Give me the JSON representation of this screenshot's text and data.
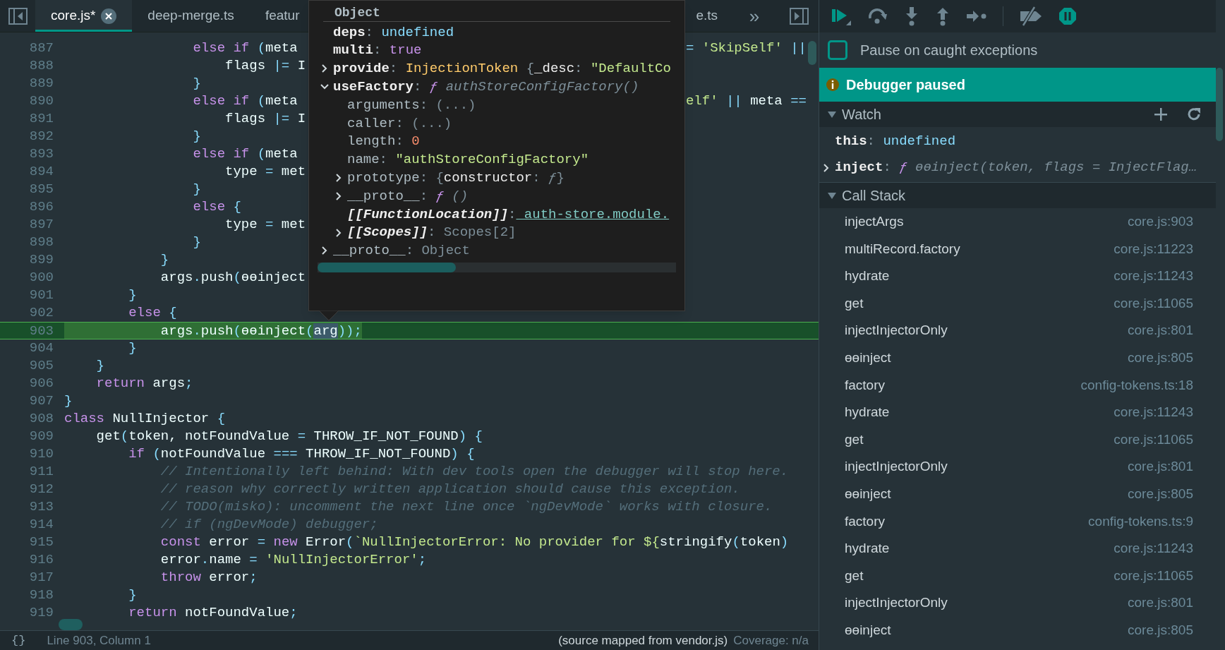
{
  "tabs": [
    {
      "label": "core.js*",
      "selected": true,
      "closable": true
    },
    {
      "label": "deep-merge.ts",
      "selected": false,
      "closable": false
    },
    {
      "label": "featur",
      "selected": false,
      "closable": false
    },
    {
      "label": "e.ts",
      "selected": false,
      "closable": false
    }
  ],
  "overflow_tabs": "»",
  "code": {
    "lines": [
      {
        "number": "887",
        "current": false,
        "tokens": [
          {
            "kind": "keyword",
            "text": "                else if"
          },
          {
            "kind": "punct",
            "text": " ("
          },
          {
            "kind": "ident",
            "text": "meta"
          }
        ],
        "tail": [
          {
            "kind": "punct",
            "text": "="
          },
          {
            "kind": "string",
            "text": " 'SkipSelf'"
          },
          {
            "kind": "punct",
            "text": " ||"
          }
        ]
      },
      {
        "number": "888",
        "current": false,
        "tokens": [
          {
            "kind": "ident",
            "text": "                    flags"
          },
          {
            "kind": "punct",
            "text": " |="
          },
          {
            "kind": "ident",
            "text": " I"
          }
        ]
      },
      {
        "number": "889",
        "current": false,
        "tokens": [
          {
            "kind": "punct",
            "text": "                }"
          }
        ]
      },
      {
        "number": "890",
        "current": false,
        "tokens": [
          {
            "kind": "keyword",
            "text": "                else if"
          },
          {
            "kind": "punct",
            "text": " ("
          },
          {
            "kind": "ident",
            "text": "meta"
          }
        ],
        "tail": [
          {
            "kind": "string",
            "text": "elf'"
          },
          {
            "kind": "punct",
            "text": " ||"
          },
          {
            "kind": "ident",
            "text": " meta"
          },
          {
            "kind": "punct",
            "text": " =="
          }
        ]
      },
      {
        "number": "891",
        "current": false,
        "tokens": [
          {
            "kind": "ident",
            "text": "                    flags"
          },
          {
            "kind": "punct",
            "text": " |="
          },
          {
            "kind": "ident",
            "text": " I"
          }
        ]
      },
      {
        "number": "892",
        "current": false,
        "tokens": [
          {
            "kind": "punct",
            "text": "                }"
          }
        ]
      },
      {
        "number": "893",
        "current": false,
        "tokens": [
          {
            "kind": "keyword",
            "text": "                else if"
          },
          {
            "kind": "punct",
            "text": " ("
          },
          {
            "kind": "ident",
            "text": "meta"
          }
        ]
      },
      {
        "number": "894",
        "current": false,
        "tokens": [
          {
            "kind": "ident",
            "text": "                    type"
          },
          {
            "kind": "punct",
            "text": " ="
          },
          {
            "kind": "ident",
            "text": " met"
          }
        ]
      },
      {
        "number": "895",
        "current": false,
        "tokens": [
          {
            "kind": "punct",
            "text": "                }"
          }
        ]
      },
      {
        "number": "896",
        "current": false,
        "tokens": [
          {
            "kind": "keyword",
            "text": "                else"
          },
          {
            "kind": "punct",
            "text": " {"
          }
        ]
      },
      {
        "number": "897",
        "current": false,
        "tokens": [
          {
            "kind": "ident",
            "text": "                    type"
          },
          {
            "kind": "punct",
            "text": " ="
          },
          {
            "kind": "ident",
            "text": " met"
          }
        ]
      },
      {
        "number": "898",
        "current": false,
        "tokens": [
          {
            "kind": "punct",
            "text": "                }"
          }
        ]
      },
      {
        "number": "899",
        "current": false,
        "tokens": [
          {
            "kind": "punct",
            "text": "            }"
          }
        ]
      },
      {
        "number": "900",
        "current": false,
        "tokens": [
          {
            "kind": "ident",
            "text": "            args"
          },
          {
            "kind": "punct",
            "text": "."
          },
          {
            "kind": "ident",
            "text": "push"
          },
          {
            "kind": "punct",
            "text": "("
          },
          {
            "kind": "ident",
            "text": "ɵɵinject"
          }
        ]
      },
      {
        "number": "901",
        "current": false,
        "tokens": [
          {
            "kind": "punct",
            "text": "        }"
          }
        ]
      },
      {
        "number": "902",
        "current": false,
        "tokens": [
          {
            "kind": "keyword",
            "text": "        else"
          },
          {
            "kind": "punct",
            "text": " {"
          }
        ]
      },
      {
        "number": "903",
        "current": true,
        "tokens": [
          {
            "kind": "ident",
            "text": "            args"
          },
          {
            "kind": "punct",
            "text": "."
          },
          {
            "kind": "ident",
            "text": "push"
          },
          {
            "kind": "punct",
            "text": "("
          },
          {
            "kind": "ident",
            "text": "ɵɵinject"
          },
          {
            "kind": "punct",
            "text": "("
          },
          {
            "kind": "hovered",
            "text": "arg"
          },
          {
            "kind": "punct",
            "text": "));"
          }
        ]
      },
      {
        "number": "904",
        "current": false,
        "tokens": [
          {
            "kind": "punct",
            "text": "        }"
          }
        ]
      },
      {
        "number": "905",
        "current": false,
        "tokens": [
          {
            "kind": "punct",
            "text": "    }"
          }
        ]
      },
      {
        "number": "906",
        "current": false,
        "tokens": [
          {
            "kind": "keyword",
            "text": "    return"
          },
          {
            "kind": "ident",
            "text": " args"
          },
          {
            "kind": "punct",
            "text": ";"
          }
        ]
      },
      {
        "number": "907",
        "current": false,
        "tokens": [
          {
            "kind": "punct",
            "text": "}"
          }
        ]
      },
      {
        "number": "908",
        "current": false,
        "tokens": [
          {
            "kind": "keyword",
            "text": "class"
          },
          {
            "kind": "ident",
            "text": " NullInjector"
          },
          {
            "kind": "punct",
            "text": " {"
          }
        ]
      },
      {
        "number": "909",
        "current": false,
        "tokens": [
          {
            "kind": "ident",
            "text": "    get"
          },
          {
            "kind": "punct",
            "text": "("
          },
          {
            "kind": "ident",
            "text": "token, notFoundValue"
          },
          {
            "kind": "punct",
            "text": " ="
          },
          {
            "kind": "ident",
            "text": " THROW_IF_NOT_FOUND"
          },
          {
            "kind": "punct",
            "text": ") {"
          }
        ]
      },
      {
        "number": "910",
        "current": false,
        "tokens": [
          {
            "kind": "keyword",
            "text": "        if"
          },
          {
            "kind": "punct",
            "text": " ("
          },
          {
            "kind": "ident",
            "text": "notFoundValue"
          },
          {
            "kind": "punct",
            "text": " ==="
          },
          {
            "kind": "ident",
            "text": " THROW_IF_NOT_FOUND"
          },
          {
            "kind": "punct",
            "text": ") {"
          }
        ]
      },
      {
        "number": "911",
        "current": false,
        "tokens": [
          {
            "kind": "comment",
            "text": "            // Intentionally left behind: With dev tools open the debugger will stop here."
          }
        ]
      },
      {
        "number": "912",
        "current": false,
        "tokens": [
          {
            "kind": "comment",
            "text": "            // reason why correctly written application should cause this exception."
          }
        ]
      },
      {
        "number": "913",
        "current": false,
        "tokens": [
          {
            "kind": "comment",
            "text": "            // TODO(misko): uncomment the next line once `ngDevMode` works with closure."
          }
        ]
      },
      {
        "number": "914",
        "current": false,
        "tokens": [
          {
            "kind": "comment",
            "text": "            // if (ngDevMode) debugger;"
          }
        ]
      },
      {
        "number": "915",
        "current": false,
        "tokens": [
          {
            "kind": "keyword",
            "text": "            const"
          },
          {
            "kind": "ident",
            "text": " error"
          },
          {
            "kind": "punct",
            "text": " ="
          },
          {
            "kind": "keyword",
            "text": " new"
          },
          {
            "kind": "ident",
            "text": " Error"
          },
          {
            "kind": "punct",
            "text": "("
          },
          {
            "kind": "string",
            "text": "`NullInjectorError: No provider for ${"
          },
          {
            "kind": "ident",
            "text": "stringify"
          },
          {
            "kind": "punct",
            "text": "("
          },
          {
            "kind": "ident",
            "text": "token"
          },
          {
            "kind": "punct",
            "text": ")"
          }
        ]
      },
      {
        "number": "916",
        "current": false,
        "tokens": [
          {
            "kind": "ident",
            "text": "            error"
          },
          {
            "kind": "punct",
            "text": "."
          },
          {
            "kind": "ident",
            "text": "name"
          },
          {
            "kind": "punct",
            "text": " ="
          },
          {
            "kind": "string",
            "text": " 'NullInjectorError'"
          },
          {
            "kind": "punct",
            "text": ";"
          }
        ]
      },
      {
        "number": "917",
        "current": false,
        "tokens": [
          {
            "kind": "keyword",
            "text": "            throw"
          },
          {
            "kind": "ident",
            "text": " error"
          },
          {
            "kind": "punct",
            "text": ";"
          }
        ]
      },
      {
        "number": "918",
        "current": false,
        "tokens": [
          {
            "kind": "punct",
            "text": "        }"
          }
        ]
      },
      {
        "number": "919",
        "current": false,
        "tokens": [
          {
            "kind": "keyword",
            "text": "        return"
          },
          {
            "kind": "ident",
            "text": " notFoundValue"
          },
          {
            "kind": "punct",
            "text": ";"
          }
        ]
      }
    ]
  },
  "popover": {
    "title": "Object",
    "properties": [
      {
        "key": "deps",
        "enumerable": true,
        "internal": false,
        "kind": "leaf",
        "value": [
          {
            "kind": "punct",
            "text": ":"
          },
          {
            "kind": "undefined",
            "text": " undefined"
          }
        ]
      },
      {
        "key": "multi",
        "enumerable": true,
        "internal": false,
        "kind": "leaf",
        "value": [
          {
            "kind": "punct",
            "text": ":"
          },
          {
            "kind": "boolean",
            "text": " true"
          }
        ]
      },
      {
        "key": "provide",
        "enumerable": true,
        "internal": false,
        "kind": "node",
        "expanded": false,
        "value": [
          {
            "kind": "punct",
            "text": ":"
          },
          {
            "kind": "class",
            "text": " InjectionToken"
          },
          {
            "kind": "punct",
            "text": " {"
          },
          {
            "kind": "plain",
            "text": "_desc"
          },
          {
            "kind": "punct",
            "text": ":"
          },
          {
            "kind": "string",
            "text": " \"DefaultCo"
          }
        ]
      },
      {
        "key": "useFactory",
        "enumerable": true,
        "internal": false,
        "kind": "node",
        "expanded": true,
        "value": [
          {
            "kind": "punct",
            "text": ":"
          },
          {
            "kind": "function",
            "text": " ƒ"
          },
          {
            "kind": "signature",
            "text": " authStoreConfigFactory()"
          }
        ],
        "children": [
          {
            "key": "arguments",
            "enumerable": false,
            "internal": false,
            "kind": "leaf",
            "value": [
              {
                "kind": "punct",
                "text": ":"
              },
              {
                "kind": "dim",
                "text": " (...)"
              }
            ]
          },
          {
            "key": "caller",
            "enumerable": false,
            "internal": false,
            "kind": "leaf",
            "value": [
              {
                "kind": "punct",
                "text": ":"
              },
              {
                "kind": "dim",
                "text": " (...)"
              }
            ]
          },
          {
            "key": "length",
            "enumerable": false,
            "internal": false,
            "kind": "leaf",
            "value": [
              {
                "kind": "punct",
                "text": ":"
              },
              {
                "kind": "number",
                "text": " 0"
              }
            ]
          },
          {
            "key": "name",
            "enumerable": false,
            "internal": false,
            "kind": "leaf",
            "value": [
              {
                "kind": "punct",
                "text": ":"
              },
              {
                "kind": "string",
                "text": " \"authStoreConfigFactory\""
              }
            ]
          },
          {
            "key": "prototype",
            "enumerable": false,
            "internal": false,
            "kind": "node",
            "expanded": false,
            "value": [
              {
                "kind": "punct",
                "text": ":"
              },
              {
                "kind": "dim",
                "text": " {"
              },
              {
                "kind": "plain",
                "text": "constructor"
              },
              {
                "kind": "dim",
                "text": ":"
              },
              {
                "kind": "signature",
                "text": " ƒ"
              },
              {
                "kind": "dim",
                "text": "}"
              }
            ]
          },
          {
            "key": "__proto__",
            "enumerable": false,
            "internal": false,
            "kind": "node",
            "expanded": false,
            "value": [
              {
                "kind": "punct",
                "text": ":"
              },
              {
                "kind": "function",
                "text": " ƒ"
              },
              {
                "kind": "signature",
                "text": " ()"
              }
            ]
          },
          {
            "key": "[[FunctionLocation]]",
            "enumerable": true,
            "internal": true,
            "kind": "leaf",
            "value": [
              {
                "kind": "punct",
                "text": ":"
              },
              {
                "kind": "link",
                "text": " auth-store.module."
              }
            ]
          },
          {
            "key": "[[Scopes]]",
            "enumerable": true,
            "internal": true,
            "kind": "node",
            "expanded": false,
            "value": [
              {
                "kind": "punct",
                "text": ":"
              },
              {
                "kind": "dim",
                "text": " Scopes[2]"
              }
            ]
          }
        ]
      },
      {
        "key": "__proto__",
        "enumerable": false,
        "internal": false,
        "kind": "node",
        "expanded": false,
        "value": [
          {
            "kind": "punct",
            "text": ":"
          },
          {
            "kind": "dim",
            "text": " Object"
          }
        ]
      }
    ]
  },
  "status_bar": {
    "format_button": "{}",
    "position": "Line 903, Column 1",
    "source": "(source mapped from vendor.js)",
    "coverage": "Coverage: n/a"
  },
  "debugger": {
    "pause_on_exceptions": true,
    "pause_on_caught": {
      "label": "Pause on caught exceptions",
      "checked": false
    },
    "banner": "Debugger paused",
    "watch": {
      "title": "Watch",
      "expanded": true,
      "items": [
        {
          "key": "this",
          "kind": "leaf",
          "value": [
            {
              "kind": "punct",
              "text": ":"
            },
            {
              "kind": "undefined",
              "text": " undefined"
            }
          ]
        },
        {
          "key": "inject",
          "kind": "node",
          "expanded": false,
          "value": [
            {
              "kind": "punct",
              "text": ":"
            },
            {
              "kind": "function",
              "text": " ƒ"
            },
            {
              "kind": "signature",
              "text": " ɵɵinject(token, flags = InjectFlag…"
            }
          ]
        }
      ]
    },
    "call_stack": {
      "title": "Call Stack",
      "expanded": true,
      "frames": [
        {
          "name": "injectArgs",
          "location": "core.js:903",
          "selected": false
        },
        {
          "name": "multiRecord.factory",
          "location": "core.js:11223",
          "selected": false
        },
        {
          "name": "hydrate",
          "location": "core.js:11243",
          "selected": false
        },
        {
          "name": "get",
          "location": "core.js:11065",
          "selected": false
        },
        {
          "name": "injectInjectorOnly",
          "location": "core.js:801",
          "selected": false
        },
        {
          "name": "ɵɵinject",
          "location": "core.js:805",
          "selected": false
        },
        {
          "name": "factory",
          "location": "config-tokens.ts:18",
          "selected": false
        },
        {
          "name": "hydrate",
          "location": "core.js:11243",
          "selected": false
        },
        {
          "name": "get",
          "location": "core.js:11065",
          "selected": false
        },
        {
          "name": "injectInjectorOnly",
          "location": "core.js:801",
          "selected": false
        },
        {
          "name": "ɵɵinject",
          "location": "core.js:805",
          "selected": false
        },
        {
          "name": "factory",
          "location": "config-tokens.ts:9",
          "selected": false
        },
        {
          "name": "hydrate",
          "location": "core.js:11243",
          "selected": false
        },
        {
          "name": "get",
          "location": "core.js:11065",
          "selected": false
        },
        {
          "name": "injectInjectorOnly",
          "location": "core.js:801",
          "selected": false
        },
        {
          "name": "ɵɵinject",
          "location": "core.js:805",
          "selected": false
        }
      ]
    }
  }
}
